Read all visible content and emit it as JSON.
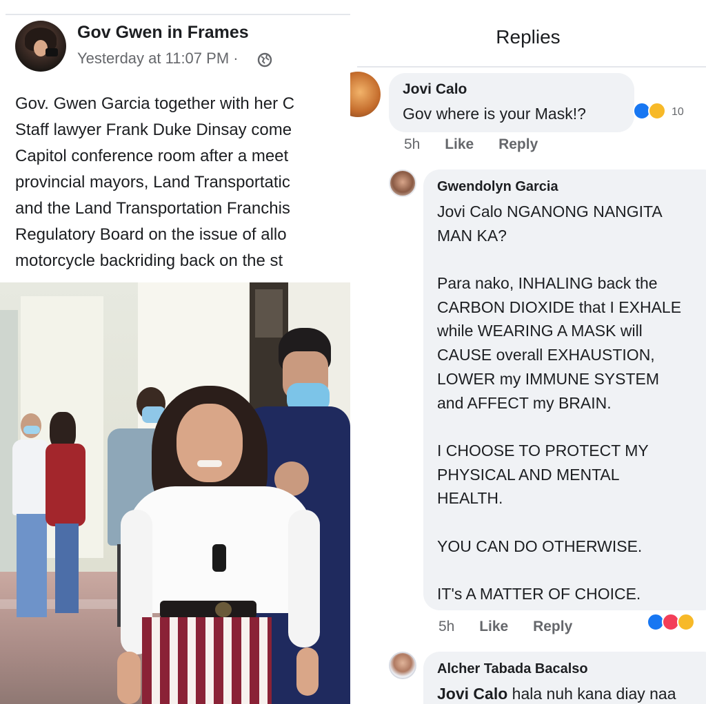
{
  "post": {
    "author": "Gov Gwen in Frames",
    "time": "Yesterday at 11:07 PM ·",
    "lines": [
      "Gov. Gwen Garcia together with her C",
      "Staff lawyer Frank Duke Dinsay come",
      "Capitol conference room after a meet",
      "provincial mayors, Land Transportatic",
      "and the Land Transportation Franchis",
      "Regulatory Board on the issue of allo",
      "motorcycle backriding back on the st"
    ]
  },
  "replies": {
    "title": "Replies",
    "comments": [
      {
        "name": "Jovi Calo",
        "text": [
          "Gov where is your Mask!?"
        ],
        "time": "5h",
        "like": "Like",
        "reply": "Reply",
        "reaction_count": "10"
      },
      {
        "name": "Gwendolyn Garcia",
        "text": [
          "Jovi Calo NGANONG NANGITA",
          "MAN KA?",
          "",
          "Para nako, INHALING back the",
          "CARBON DIOXIDE  that I EXHALE",
          "while WEARING A MASK will",
          "CAUSE overall EXHAUSTION,",
          "LOWER my IMMUNE SYSTEM",
          "and AFFECT my BRAIN.",
          "",
          "I CHOOSE TO PROTECT MY",
          "PHYSICAL AND MENTAL",
          "HEALTH.",
          "",
          "YOU CAN DO OTHERWISE.",
          "",
          "IT's A MATTER OF CHOICE."
        ],
        "time": "5h",
        "like": "Like",
        "reply": "Reply"
      },
      {
        "name": "Alcher Tabada Bacalso",
        "mention": "Jovi Calo",
        "text_rest": " hala nuh kana diay naa"
      }
    ]
  },
  "icons": {
    "globe": "globe-icon",
    "like_reaction": "like-reaction-icon",
    "haha_reaction": "haha-reaction-icon",
    "love_reaction": "love-reaction-icon"
  },
  "colors": {
    "like_blue": "#1877f2",
    "love_red": "#f33e58",
    "haha_yellow": "#f7b928",
    "bubble": "#f0f2f5",
    "muted_text": "#65676b"
  }
}
